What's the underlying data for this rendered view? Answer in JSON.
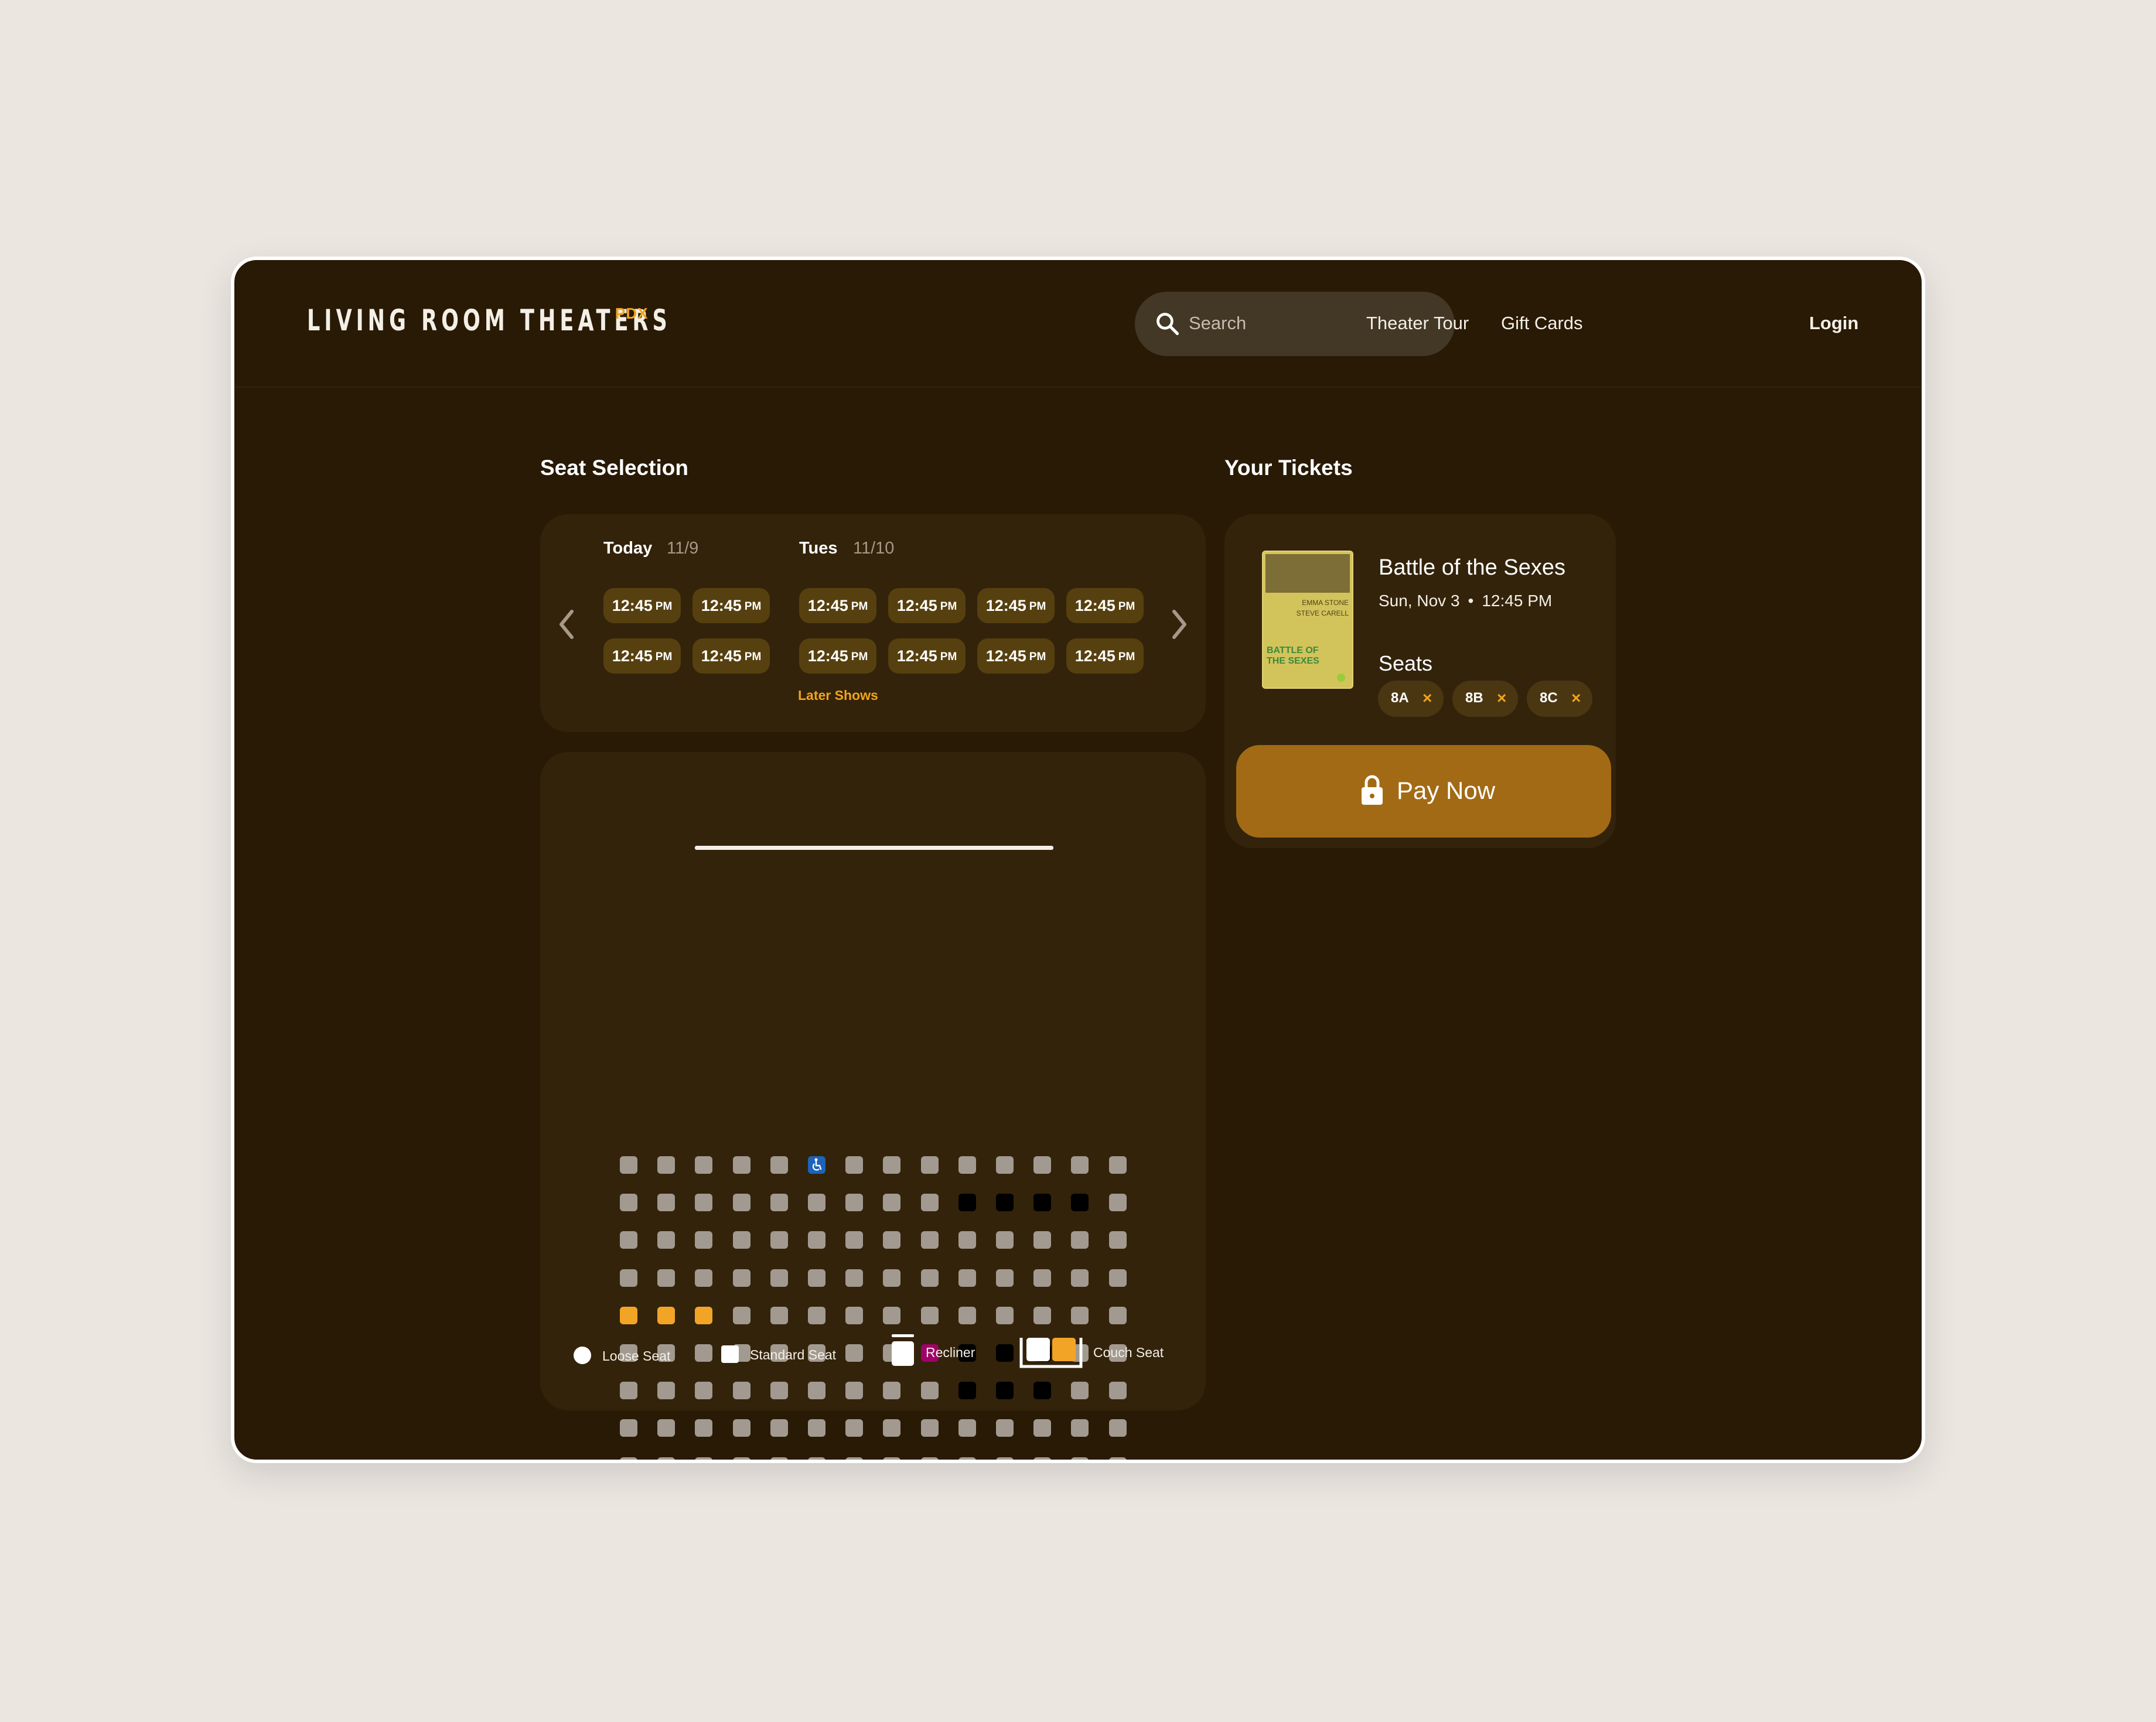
{
  "header": {
    "logo": "LIVING ROOM THEATERS",
    "logo_sub": "PDX",
    "search_placeholder": "Search",
    "nav": [
      "Theater Tour",
      "Gift Cards",
      "Login"
    ]
  },
  "seat_selection": {
    "title": "Seat Selection",
    "days": [
      {
        "label": "Today",
        "date": "11/9",
        "times": [
          "12:45",
          "12:45",
          "12:45",
          "12:45"
        ]
      },
      {
        "label": "Tues",
        "date": "11/10",
        "times": [
          "12:45",
          "12:45",
          "12:45",
          "12:45",
          "12:45",
          "12:45",
          "12:45",
          "12:45"
        ]
      }
    ],
    "time_suffix": "PM",
    "later_shows": "Later Shows",
    "seat_map": {
      "rows": 10,
      "cols": 14,
      "accessible": [
        [
          0,
          5
        ]
      ],
      "taken": [
        [
          1,
          9
        ],
        [
          1,
          10
        ],
        [
          1,
          11
        ],
        [
          1,
          12
        ],
        [
          5,
          9
        ],
        [
          5,
          10
        ],
        [
          5,
          11
        ],
        [
          6,
          9
        ],
        [
          6,
          10
        ],
        [
          6,
          11
        ]
      ],
      "selected": [
        [
          4,
          0
        ],
        [
          4,
          1
        ],
        [
          4,
          2
        ]
      ],
      "held": [
        [
          5,
          8
        ]
      ]
    },
    "legend": [
      "Loose Seat",
      "Standard Seat",
      "Recliner",
      "Couch Seat"
    ]
  },
  "tickets": {
    "title": "Your Tickets",
    "movie_title": "Battle of the Sexes",
    "date": "Sun, Nov 3",
    "time": "12:45 PM",
    "poster": {
      "names": [
        "EMMA STONE",
        "STEVE CARELL"
      ],
      "title_lines": [
        "BATTLE OF",
        "THE SEXES"
      ]
    },
    "seats_label": "Seats",
    "seats": [
      "8A",
      "8B",
      "8C"
    ],
    "pay_label": "Pay Now"
  },
  "colors": {
    "background": "#281a04",
    "accent": "#f0a41c",
    "pay_button": "#a36a15",
    "seat_available": "#a29a90",
    "seat_taken": "#000000",
    "seat_selected": "#f2a427",
    "seat_held": "#a0006a",
    "seat_accessible": "#1e63b8"
  }
}
